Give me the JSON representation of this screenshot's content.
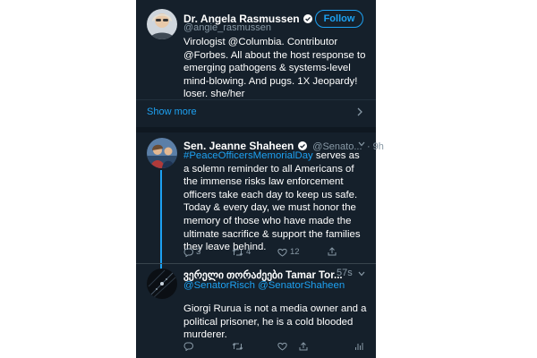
{
  "profile": {
    "name": "Dr. Angela Rasmussen",
    "handle": "@angie_rasmussen",
    "follow_label": "Follow",
    "bio": "Virologist @Columbia. Contributor @Forbes. All about the host response to emerging pathogens & systems-level mind-blowing. And pugs. 1X Jeopardy! loser. she/her",
    "show_more_label": "Show more"
  },
  "tweet1": {
    "name": "Sen. Jeanne Shaheen",
    "handle": "@Senato...",
    "time": "· 9h",
    "hashtag": "#PeaceOfficersMemorialDay",
    "text": " serves as a solemn reminder to all Americans of the immense risks law enforcement officers take each day to keep us safe. Today & every day, we must honor the memory of those who have made the ultimate sacrifice & support the families they leave behind.",
    "replies": "3",
    "retweets": "4",
    "likes": "12"
  },
  "tweet2": {
    "name": "ვერელი თორაძეები Tamar Tor...",
    "time": "57s",
    "mention1": "@SenatorRisch",
    "mention2": "@SenatorShaheen",
    "text": "Giorgi Rurua is not a media owner and a political prisoner, he is a cold blooded murderer."
  },
  "colors": {
    "background": "#15202b",
    "accent": "#1da1f2",
    "muted": "#8899a6",
    "divider": "#38444d"
  },
  "icons": [
    "verified-badge-icon",
    "chevron-right-icon",
    "chevron-down-icon",
    "reply-icon",
    "retweet-icon",
    "like-icon",
    "share-icon",
    "analytics-icon"
  ]
}
